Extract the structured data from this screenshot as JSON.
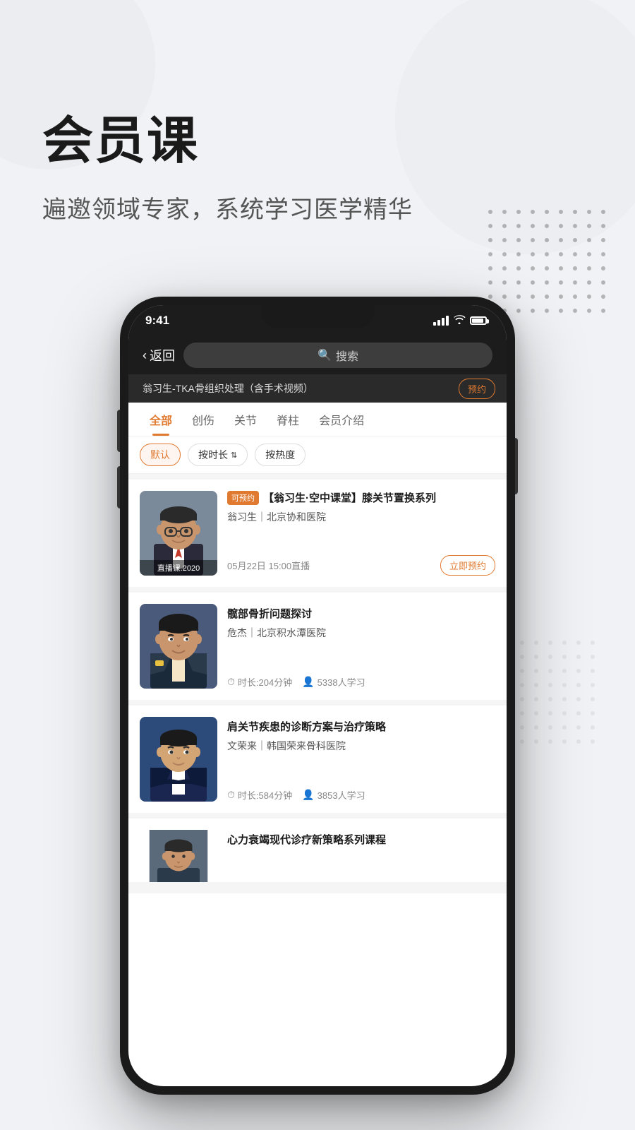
{
  "page": {
    "bg_title": "会员课",
    "bg_subtitle": "遍邀领域专家，系统学习医学精华"
  },
  "status_bar": {
    "time": "9:41",
    "signal": "signal",
    "wifi": "wifi",
    "battery": "battery"
  },
  "nav": {
    "back_label": "返回",
    "search_placeholder": "搜索"
  },
  "sub_nav": {
    "title": "翁习生-TKA骨组织处理（含手术视频）",
    "book_label": "预约"
  },
  "tabs": [
    {
      "label": "全部",
      "active": true
    },
    {
      "label": "创伤",
      "active": false
    },
    {
      "label": "关节",
      "active": false
    },
    {
      "label": "脊柱",
      "active": false
    },
    {
      "label": "会员介绍",
      "active": false
    }
  ],
  "filters": [
    {
      "label": "默认",
      "active": true
    },
    {
      "label": "按时长",
      "active": false,
      "has_arrow": true
    },
    {
      "label": "按热度",
      "active": false
    }
  ],
  "courses": [
    {
      "id": 1,
      "tag": "可预约",
      "title": "【翁习生·空中课堂】膝关节置换系列",
      "doctor": "翁习生｜北京协和医院",
      "date": "05月22日 15:00直播",
      "thumb_label": "直播课.2020",
      "has_book_btn": true,
      "book_label": "立即预约",
      "duration": null,
      "learners": null
    },
    {
      "id": 2,
      "tag": null,
      "title": "髋部骨折问题探讨",
      "doctor": "危杰｜北京积水潭医院",
      "date": null,
      "thumb_label": null,
      "has_book_btn": false,
      "book_label": null,
      "duration": "时长:204分钟",
      "learners": "5338人学习"
    },
    {
      "id": 3,
      "tag": null,
      "title": "肩关节疾患的诊断方案与治疗策略",
      "doctor": "文荣来｜韩国荣来骨科医院",
      "date": null,
      "thumb_label": null,
      "has_book_btn": false,
      "book_label": null,
      "duration": "时长:584分钟",
      "learners": "3853人学习"
    },
    {
      "id": 4,
      "tag": null,
      "title": "心力衰竭现代诊疗新策略系列课程",
      "doctor": "",
      "date": null,
      "thumb_label": null,
      "has_book_btn": false,
      "book_label": null,
      "duration": null,
      "learners": null
    }
  ]
}
